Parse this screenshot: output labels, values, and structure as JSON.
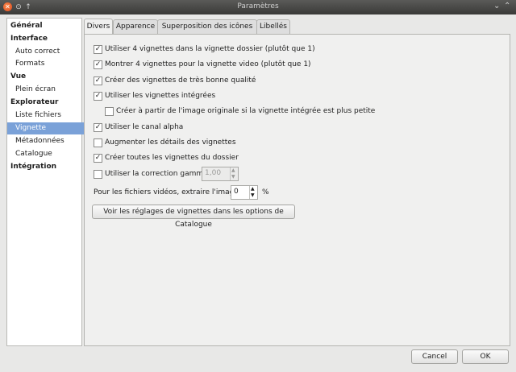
{
  "window": {
    "title": "Paramètres"
  },
  "sidebar": {
    "items": [
      {
        "label": "Général",
        "level": "head"
      },
      {
        "label": "Interface",
        "level": "head"
      },
      {
        "label": "Auto correct",
        "level": "sub"
      },
      {
        "label": "Formats",
        "level": "sub"
      },
      {
        "label": "Vue",
        "level": "head"
      },
      {
        "label": "Plein écran",
        "level": "sub"
      },
      {
        "label": "Explorateur",
        "level": "head"
      },
      {
        "label": "Liste fichiers",
        "level": "sub"
      },
      {
        "label": "Vignette",
        "level": "sub",
        "selected": true
      },
      {
        "label": "Métadonnées",
        "level": "sub"
      },
      {
        "label": "Catalogue",
        "level": "sub"
      },
      {
        "label": "Intégration",
        "level": "head"
      }
    ]
  },
  "tabs": [
    "Divers",
    "Apparence",
    "Superposition des icônes",
    "Libellés"
  ],
  "active_tab": "Divers",
  "options": [
    {
      "label": "Utiliser 4 vignettes dans la vignette dossier (plutôt que 1)",
      "checked": true
    },
    {
      "label": "Montrer 4 vignettes pour la vignette video (plutôt que 1)",
      "checked": true
    },
    {
      "label": "Créer des vignettes de très bonne qualité",
      "checked": true
    },
    {
      "label": "Utiliser les vignettes intégrées",
      "checked": true
    },
    {
      "label": "Créer à partir de l'image originale si la vignette intégrée est plus petite",
      "checked": false
    },
    {
      "label": "Utiliser le canal alpha",
      "checked": true
    },
    {
      "label": "Augmenter les détails des vignettes",
      "checked": false
    },
    {
      "label": "Créer toutes les vignettes du dossier",
      "checked": true
    },
    {
      "label": "Utiliser la correction gamma",
      "checked": false
    }
  ],
  "gamma_value": "1,00",
  "video_extract": {
    "label": "Pour les fichiers vidéos, extraire l'image à",
    "value": "0",
    "unit": "%"
  },
  "catalog_button": "Voir les réglages de vignettes dans les options de Catalogue",
  "footer": {
    "cancel": "Cancel",
    "ok": "OK"
  },
  "colors": {
    "selection": "#7aa1d8",
    "titlebar": "#3f3f3d"
  }
}
